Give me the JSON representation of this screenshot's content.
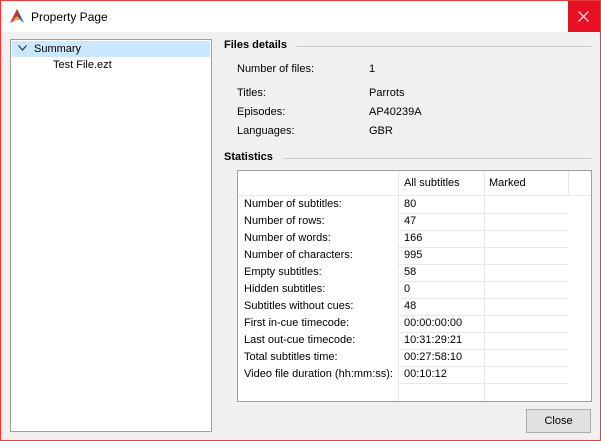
{
  "window": {
    "title": "Property Page",
    "accent_color": "#e81123",
    "app_icon": "app-logo-icon"
  },
  "tree": {
    "items": [
      {
        "label": "Summary",
        "expanded": true,
        "selected": true
      },
      {
        "label": "Test File.ezt"
      }
    ]
  },
  "files_details": {
    "header": "Files details",
    "rows": [
      {
        "label": "Number of files:",
        "value": "1"
      },
      {
        "label": "Titles:",
        "value": "Parrots"
      },
      {
        "label": "Episodes:",
        "value": "AP40239A"
      },
      {
        "label": "Languages:",
        "value": "GBR"
      }
    ]
  },
  "statistics": {
    "header": "Statistics",
    "columns": [
      "",
      "All subtitles",
      "Marked"
    ],
    "rows": [
      {
        "label": "Number of subtitles:",
        "all": "80",
        "marked": ""
      },
      {
        "label": "Number of rows:",
        "all": "47",
        "marked": ""
      },
      {
        "label": "Number of words:",
        "all": "166",
        "marked": ""
      },
      {
        "label": "Number of characters:",
        "all": "995",
        "marked": ""
      },
      {
        "label": "Empty subtitles:",
        "all": "58",
        "marked": ""
      },
      {
        "label": "Hidden subtitles:",
        "all": "0",
        "marked": ""
      },
      {
        "label": "Subtitles without cues:",
        "all": "48",
        "marked": ""
      },
      {
        "label": "First in-cue timecode:",
        "all": "00:00:00:00",
        "marked": ""
      },
      {
        "label": "Last out-cue timecode:",
        "all": "10:31:29:21",
        "marked": ""
      },
      {
        "label": "Total subtitles time:",
        "all": "00:27:58:10",
        "marked": ""
      },
      {
        "label": "Video file duration (hh:mm:ss):",
        "all": "00:10:12",
        "marked": ""
      }
    ]
  },
  "footer": {
    "close_label": "Close"
  }
}
